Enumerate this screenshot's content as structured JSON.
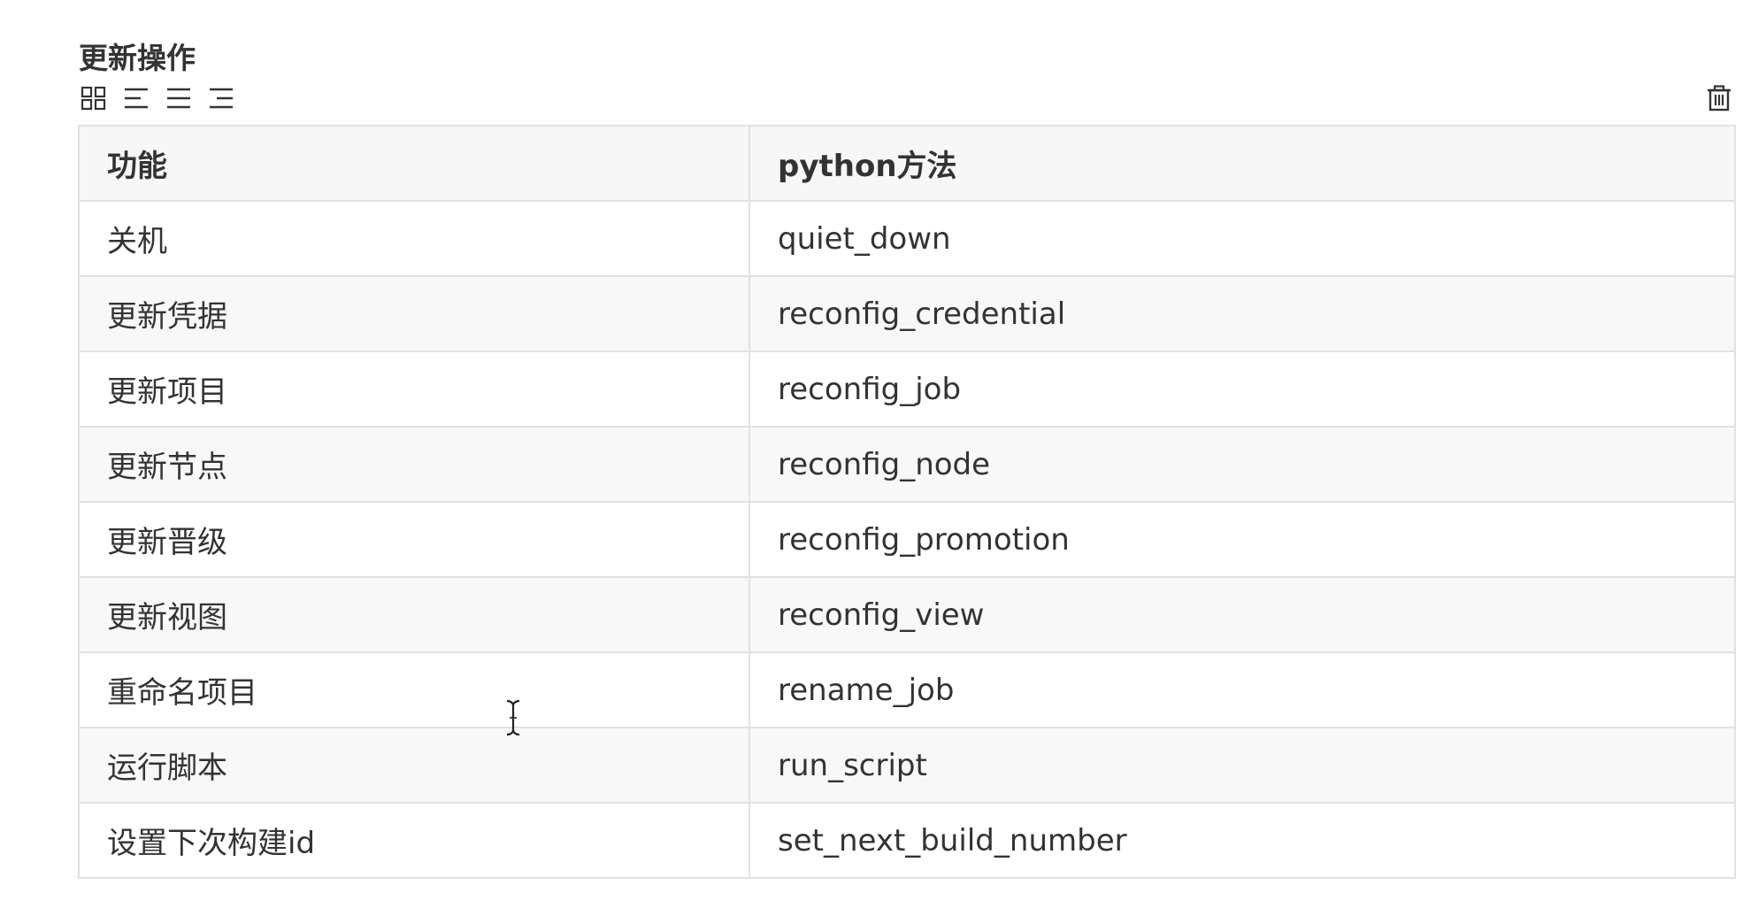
{
  "section": {
    "title": "更新操作"
  },
  "toolbar": {
    "icons": [
      "grid-icon",
      "align-left-icon",
      "align-center-icon",
      "align-right-icon"
    ],
    "delete_icon": "trash-icon"
  },
  "table": {
    "headers": [
      "功能",
      "python方法"
    ],
    "rows": [
      [
        "关机",
        "quiet_down"
      ],
      [
        "更新凭据",
        "reconfig_credential"
      ],
      [
        "更新项目",
        "reconfig_job"
      ],
      [
        "更新节点",
        "reconfig_node"
      ],
      [
        "更新晋级",
        "reconfig_promotion"
      ],
      [
        "更新视图",
        "reconfig_view"
      ],
      [
        "重命名项目",
        "rename_job"
      ],
      [
        "运行脚本",
        "run_script"
      ],
      [
        "设置下次构建id",
        "set_next_build_number"
      ]
    ]
  },
  "colors": {
    "border": "#dfe2e5",
    "header_bg": "#f7f7f7",
    "stripe_bg": "#f8f8f8",
    "text": "#333333",
    "icon": "#333333"
  }
}
